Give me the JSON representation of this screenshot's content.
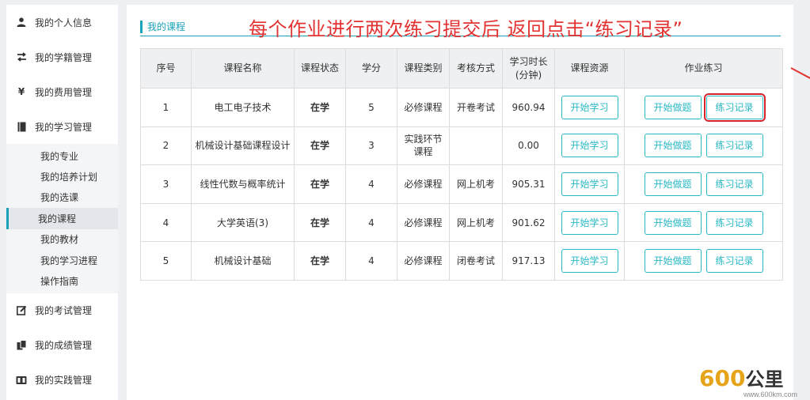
{
  "sidebar": {
    "top_items": [
      {
        "label": "我的个人信息",
        "icon": "person-icon"
      },
      {
        "label": "我的学籍管理",
        "icon": "exchange-icon"
      },
      {
        "label": "我的费用管理",
        "icon": "yen-icon"
      },
      {
        "label": "我的学习管理",
        "icon": "book-icon"
      }
    ],
    "sub_items": [
      {
        "label": "我的专业"
      },
      {
        "label": "我的培养计划"
      },
      {
        "label": "我的选课"
      },
      {
        "label": "我的课程",
        "active": true
      },
      {
        "label": "我的教材"
      },
      {
        "label": "我的学习进程"
      },
      {
        "label": "操作指南"
      }
    ],
    "bottom_items": [
      {
        "label": "我的考试管理",
        "icon": "edit-icon"
      },
      {
        "label": "我的成绩管理",
        "icon": "copy-icon"
      },
      {
        "label": "我的实践管理",
        "icon": "practice-icon"
      }
    ]
  },
  "content": {
    "title": "我的课程",
    "annotation": "每个作业进行两次练习提交后 返回点击“练习记录”",
    "table": {
      "headers": [
        "序号",
        "课程名称",
        "课程状态",
        "学分",
        "课程类别",
        "考核方式",
        "学习时长(分钟)",
        "课程资源",
        "作业练习"
      ],
      "duration_header_line1": "学习时长",
      "duration_header_line2": "(分钟)",
      "rows": [
        {
          "no": "1",
          "name": "电工电子技术",
          "status": "在学",
          "credit": "5",
          "category": "必修课程",
          "exam": "开卷考试",
          "duration": "960.94",
          "resource_btn": "开始学习",
          "do_btn": "开始做题",
          "record_btn": "练习记录"
        },
        {
          "no": "2",
          "name": "机械设计基础课程设计",
          "status": "在学",
          "credit": "3",
          "category": "实践环节课程",
          "exam": "",
          "duration": "0.00",
          "resource_btn": "开始学习",
          "do_btn": "开始做题",
          "record_btn": "练习记录"
        },
        {
          "no": "3",
          "name": "线性代数与概率统计",
          "status": "在学",
          "credit": "4",
          "category": "必修课程",
          "exam": "网上机考",
          "duration": "905.31",
          "resource_btn": "开始学习",
          "do_btn": "开始做题",
          "record_btn": "练习记录"
        },
        {
          "no": "4",
          "name": "大学英语(3)",
          "status": "在学",
          "credit": "4",
          "category": "必修课程",
          "exam": "网上机考",
          "duration": "901.62",
          "resource_btn": "开始学习",
          "do_btn": "开始做题",
          "record_btn": "练习记录"
        },
        {
          "no": "5",
          "name": "机械设计基础",
          "status": "在学",
          "credit": "4",
          "category": "必修课程",
          "exam": "闭卷考试",
          "duration": "917.13",
          "resource_btn": "开始学习",
          "do_btn": "开始做题",
          "record_btn": "练习记录"
        }
      ]
    }
  },
  "watermark": {
    "logo_num": "600",
    "logo_word": "公里",
    "url": "www.600km.com"
  },
  "colors": {
    "accent": "#1aa3b8",
    "button": "#2ab8c6",
    "status": "#e39b16",
    "annotation": "#e23232"
  }
}
